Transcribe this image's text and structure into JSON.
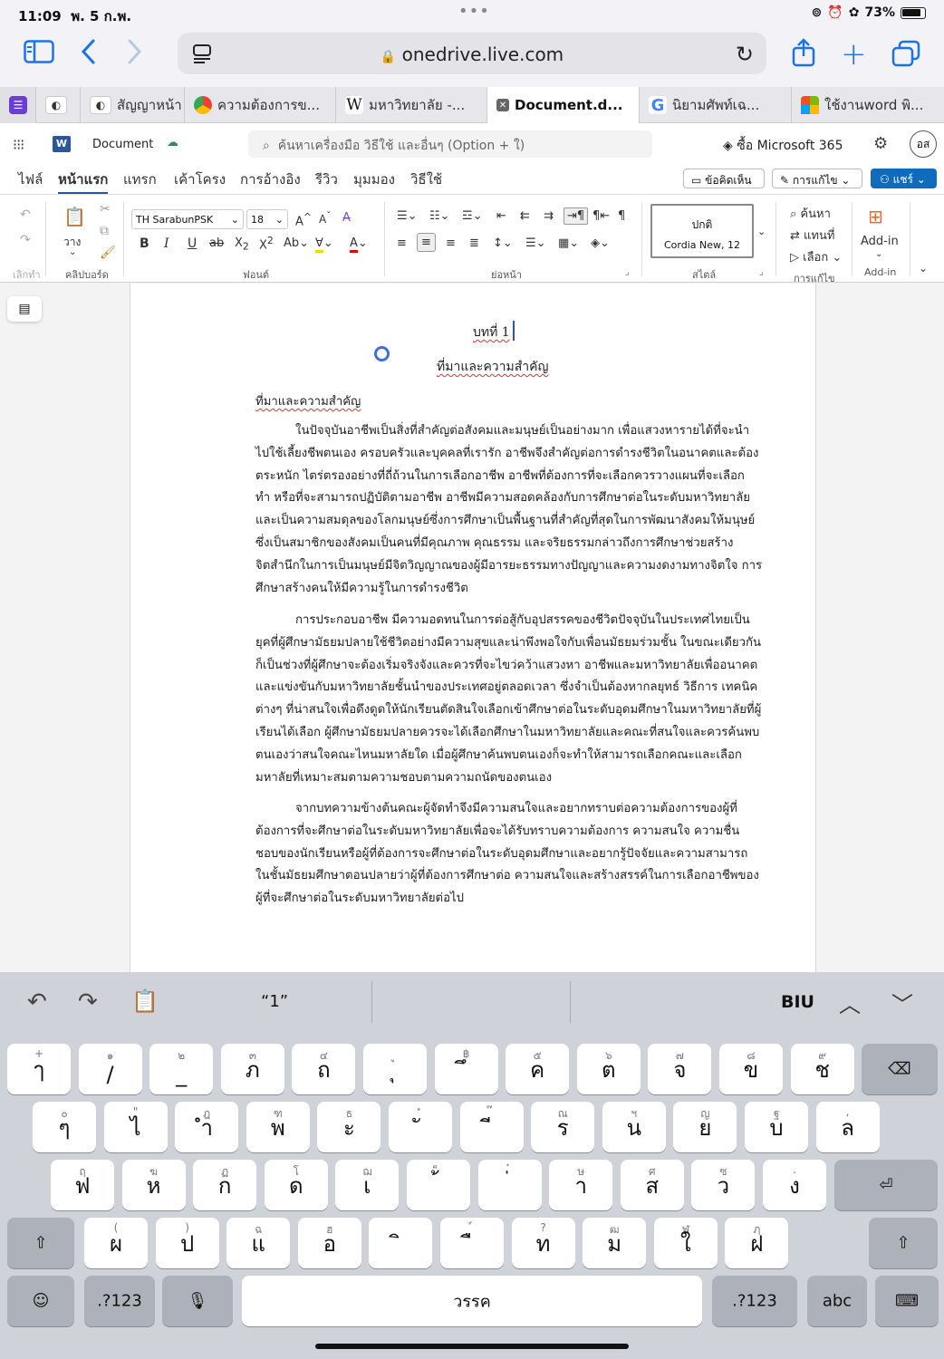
{
  "status": {
    "time": "11:09",
    "date": "พ. 5 ก.พ.",
    "battery": "73%"
  },
  "browser": {
    "url": "onedrive.live.com"
  },
  "tabs": [
    {
      "label": "",
      "icon": "gdrive",
      "color": "#fff"
    },
    {
      "label": "สัญญาหน้า",
      "icon": "gdrive",
      "color": "#fff"
    },
    {
      "label": "ความต้องการข...",
      "icon": "chrome",
      "color": "#ea4335"
    },
    {
      "label": "มหาวิทยาลัย -...",
      "icon": "W",
      "color": "#fff"
    },
    {
      "label": "Document.d...",
      "icon": "x",
      "color": "#555"
    },
    {
      "label": "นิยามศัพท์เฉ...",
      "icon": "G",
      "color": "#fff"
    },
    {
      "label": "ใช้งานword พิ...",
      "icon": "ms",
      "color": "#fff"
    }
  ],
  "word": {
    "doc_name": "Document",
    "search_placeholder": "ค้นหาเครื่องมือ วิธีใช้ และอื่นๆ (Option + ใ)",
    "buy": "ซื้อ Microsoft 365",
    "avatar": "อส",
    "menu": [
      "ไฟล์",
      "หน้าแรก",
      "แทรก",
      "เค้าโครง",
      "การอ้างอิง",
      "รีวิว",
      "มุมมอง",
      "วิธีใช้"
    ],
    "comments": "ข้อคิดเห็น",
    "editing": "การแก้ไข",
    "share": "แชร์"
  },
  "ribbon": {
    "undo_group": "เลิกทำ",
    "paste": "วาง",
    "clipboard": "คลิปบอร์ด",
    "font_name": "TH SarabunPSK",
    "font_size": "18",
    "font_group": "ฟอนต์",
    "paragraph_group": "ย่อหน้า",
    "style_name": "ปกติ",
    "style_font": "Cordia New, 12",
    "styles_group": "สไตล์",
    "find": "ค้นหา",
    "replace": "แทนที่",
    "select": "เลือก",
    "editing_group": "การแก้ไข",
    "addin": "Add-in",
    "addin_group": "Add-in"
  },
  "document": {
    "heading": "บทที่ 1",
    "subheading": "ที่มาและความสำคัญ",
    "section_label": "ที่มาและความสำคัญ",
    "p1": [
      "ในปัจจุบันอาชีพเป็นสิ่งที่สำคัญต่อสังคมและมนุษย์เป็นอย่างมาก เพื่อแสวงหารายได้ที่จะนำ",
      "ไปใช้เลี้ยงชีพตนเอง ครอบครัวและบุคคลที่เรารัก อาชีพจึงสำคัญต่อการดำรงชีวิตในอนาคตและต้อง",
      "ตระหนัก ไตร่ตรองอย่างที่ถี่ถ้วนในการเลือกอาชีพ อาชีพที่ต้องการที่จะเลือกควรวางแผนที่จะเลือก",
      "ทำ หรือที่จะสามารถปฏิบัติตามอาชีพ อาชีพมีความสอดคล้องกับการศึกษาต่อในระดับมหาวิทยาลัย",
      "และเป็นความสมดุลของโลกมนุษย์ซึ่งการศึกษาเป็นพื้นฐานที่สำคัญที่สุดในการพัฒนาสังคมให้มนุษย์",
      "ซึ่งเป็นสมาชิกของสังคมเป็นคนที่มีคุณภาพ คุณธรรม และจริยธรรมกล่าวถึงการศึกษาช่วยสร้าง",
      "จิตสำนึกในการเป็นมนุษย์มีจิตวิญญาณของผู้มีอารยะธรรมทางปัญญาและความงดงามทางจิตใจ การ",
      "ศึกษาสร้างคนให้มีความรู้ในการดำรงชีวิต"
    ],
    "p2": [
      "การประกอบอาชีพ มีความอดทนในการต่อสู้กับอุปสรรคของชีวิตปัจจุบันในประเทศไทยเป็น",
      "ยุคที่ผู้ศึกษามัธยมปลายใช้ชีวิตอย่างมีความสุขและน่าพึงพอใจกับเพื่อนมัธยมร่วมชั้น ในขณะเดียวกัน",
      "ก็เป็นช่วงที่ผู้ศึกษาจะต้องเริ่มจริงจังและควรที่จะไขว่คว้าแสวงหา อาชีพและมหาวิทยาลัยเพื่ออนาคต",
      "และแข่งขันกับมหาวิทยาลัยชั้นนำของประเทศอยู่ตลอดเวลา ซึ่งจำเป็นต้องหากลยุทธ์ วิธีการ เทคนิค",
      "ต่างๆ ที่น่าสนใจเพื่อดึงดูดให้นักเรียนตัดสินใจเลือกเข้าศึกษาต่อในระดับอุดมศึกษาในมหาวิทยาลัยที่ผู้",
      "เรียนได้เลือก ผู้ศึกษามัธยมปลายควรจะได้เลือกศึกษาในมหาวิทยาลัยและคณะที่สนใจและควรค้นพบ",
      "ตนเองว่าสนใจคณะไหนมหาลัยใด เมื่อผู้ศึกษาค้นพบตนเองก็จะทำให้สามารถเลือกคณะและเลือก",
      "มหาลัยที่เหมาะสมตามความชอบตามความถนัดของตนเอง"
    ],
    "p3": [
      "จากบทความข้างต้นคณะผู้จัดทำจึงมีความสนใจและอยากทราบต่อความต้องการของผู้ที่",
      "ต้องการที่จะศึกษาต่อในระดับมหาวิทยาลัยเพื่อจะได้รับทราบความต้องการ ความสนใจ ความชื่น",
      "ชอบของนักเรียนหรือผู้ที่ต้องการจะศึกษาต่อในระดับอุดมศึกษาและอยากรู้ปัจจัยและความสามารถ",
      "ในชั้นมัธยมศึกษาตอนปลายว่าผู้ที่ต้องการศึกษาต่อ ความสนใจและสร้างสรรค์ในการเลือกอาชีพของ",
      "ผู้ที่จะศึกษาต่อในระดับมหาวิทยาลัยต่อไป"
    ]
  },
  "keyboard": {
    "suggestion": "“1”",
    "biu": "BIU",
    "row1": [
      [
        "+",
        "ๅ"
      ],
      [
        "๑",
        "/"
      ],
      [
        "๒",
        "_"
      ],
      [
        "๓",
        "ภ"
      ],
      [
        "๔",
        "ถ"
      ],
      [
        "ู",
        "ุ"
      ],
      [
        "฿",
        "ึ"
      ],
      [
        "๕",
        "ค"
      ],
      [
        "๖",
        "ต"
      ],
      [
        "๗",
        "จ"
      ],
      [
        "๘",
        "ข"
      ],
      [
        "๙",
        "ช"
      ]
    ],
    "row2": [
      [
        "๐",
        "ๆ"
      ],
      [
        "\"",
        "ไ"
      ],
      [
        "ฎ",
        "ำ"
      ],
      [
        "ฑ",
        "พ"
      ],
      [
        "ธ",
        "ะ"
      ],
      [
        "ํ",
        "ั"
      ],
      [
        "๊",
        "ี"
      ],
      [
        "ณ",
        "ร"
      ],
      [
        "ฯ",
        "น"
      ],
      [
        "ญ",
        "ย"
      ],
      [
        "ฐ",
        "บ"
      ],
      [
        ",",
        "ล"
      ]
    ],
    "row3": [
      [
        "ฤ",
        "ฟ"
      ],
      [
        "ฆ",
        "ห"
      ],
      [
        "ฏ",
        "ก"
      ],
      [
        "โ",
        "ด"
      ],
      [
        "ฌ",
        "เ"
      ],
      [
        "็",
        "้"
      ],
      [
        "๋",
        "่"
      ],
      [
        "ษ",
        "า"
      ],
      [
        "ศ",
        "ส"
      ],
      [
        "ซ",
        "ว"
      ],
      [
        ".",
        "ง"
      ]
    ],
    "row4": [
      [
        "(",
        "ผ"
      ],
      [
        ")",
        "ป"
      ],
      [
        "ฉ",
        "แ"
      ],
      [
        "ฮ",
        "อ"
      ],
      [
        "",
        "ิ"
      ],
      [
        "์",
        "ื"
      ],
      [
        "?",
        "ท"
      ],
      [
        "ฒ",
        "ม"
      ],
      [
        "ฬ",
        "ใ"
      ],
      [
        "ฦ",
        "ฝ"
      ]
    ],
    "num_label": ".?123",
    "space": "วรรค",
    "abc": "abc"
  }
}
